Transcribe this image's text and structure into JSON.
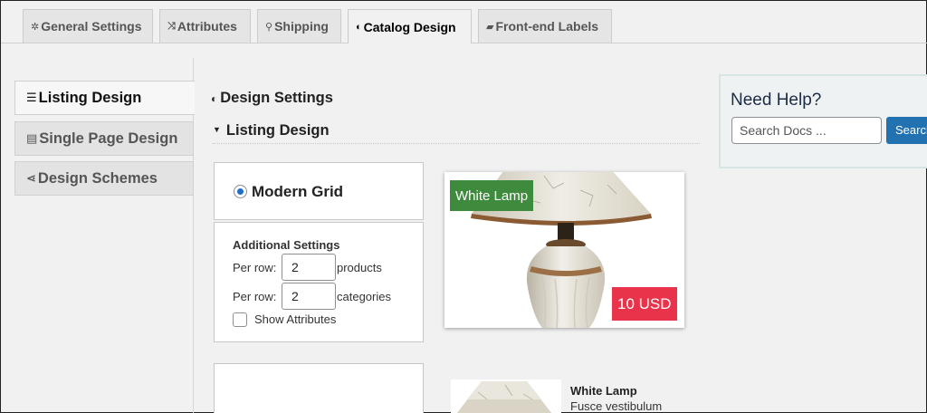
{
  "top_tabs": [
    {
      "label": "General Settings",
      "icon": "gear-icon",
      "glyph": "✲",
      "active": false
    },
    {
      "label": "Attributes",
      "icon": "shuffle-icon",
      "glyph": "⤨",
      "active": false
    },
    {
      "label": "Shipping",
      "icon": "location-pin-icon",
      "glyph": "⚲",
      "active": false
    },
    {
      "label": "Catalog Design",
      "icon": "palette-icon",
      "glyph": "◐",
      "active": true
    },
    {
      "label": "Front-end Labels",
      "icon": "comment-icon",
      "glyph": "▰",
      "active": false
    }
  ],
  "side_tabs": [
    {
      "label": "Listing Design",
      "icon": "list-icon",
      "glyph": "☰",
      "active": true
    },
    {
      "label": "Single Page Design",
      "icon": "page-icon",
      "glyph": "▤",
      "active": false
    },
    {
      "label": "Design Schemes",
      "icon": "share-icon",
      "glyph": "⋖",
      "active": false
    }
  ],
  "main": {
    "section_title": "Design Settings",
    "subsection_title": "Listing Design",
    "grid_option": {
      "label": "Modern Grid",
      "selected": true
    },
    "additional": {
      "title": "Additional Settings",
      "per_row_label": "Per row:",
      "products_value": "2",
      "products_unit": "products",
      "categories_value": "2",
      "categories_unit": "categories",
      "show_attributes_label": "Show Attributes",
      "show_attributes_checked": false
    }
  },
  "preview": {
    "product_name": "White Lamp",
    "price": "10 USD",
    "list_name": "White Lamp",
    "list_desc": "Fusce vestibulum"
  },
  "help": {
    "title": "Need Help?",
    "search_placeholder": "Search Docs ...",
    "search_button": "Search"
  },
  "colors": {
    "name_badge": "#3e8b3e",
    "price_badge": "#e8334a",
    "primary_button": "#2271b1",
    "radio_selected": "#1e6fc6"
  }
}
